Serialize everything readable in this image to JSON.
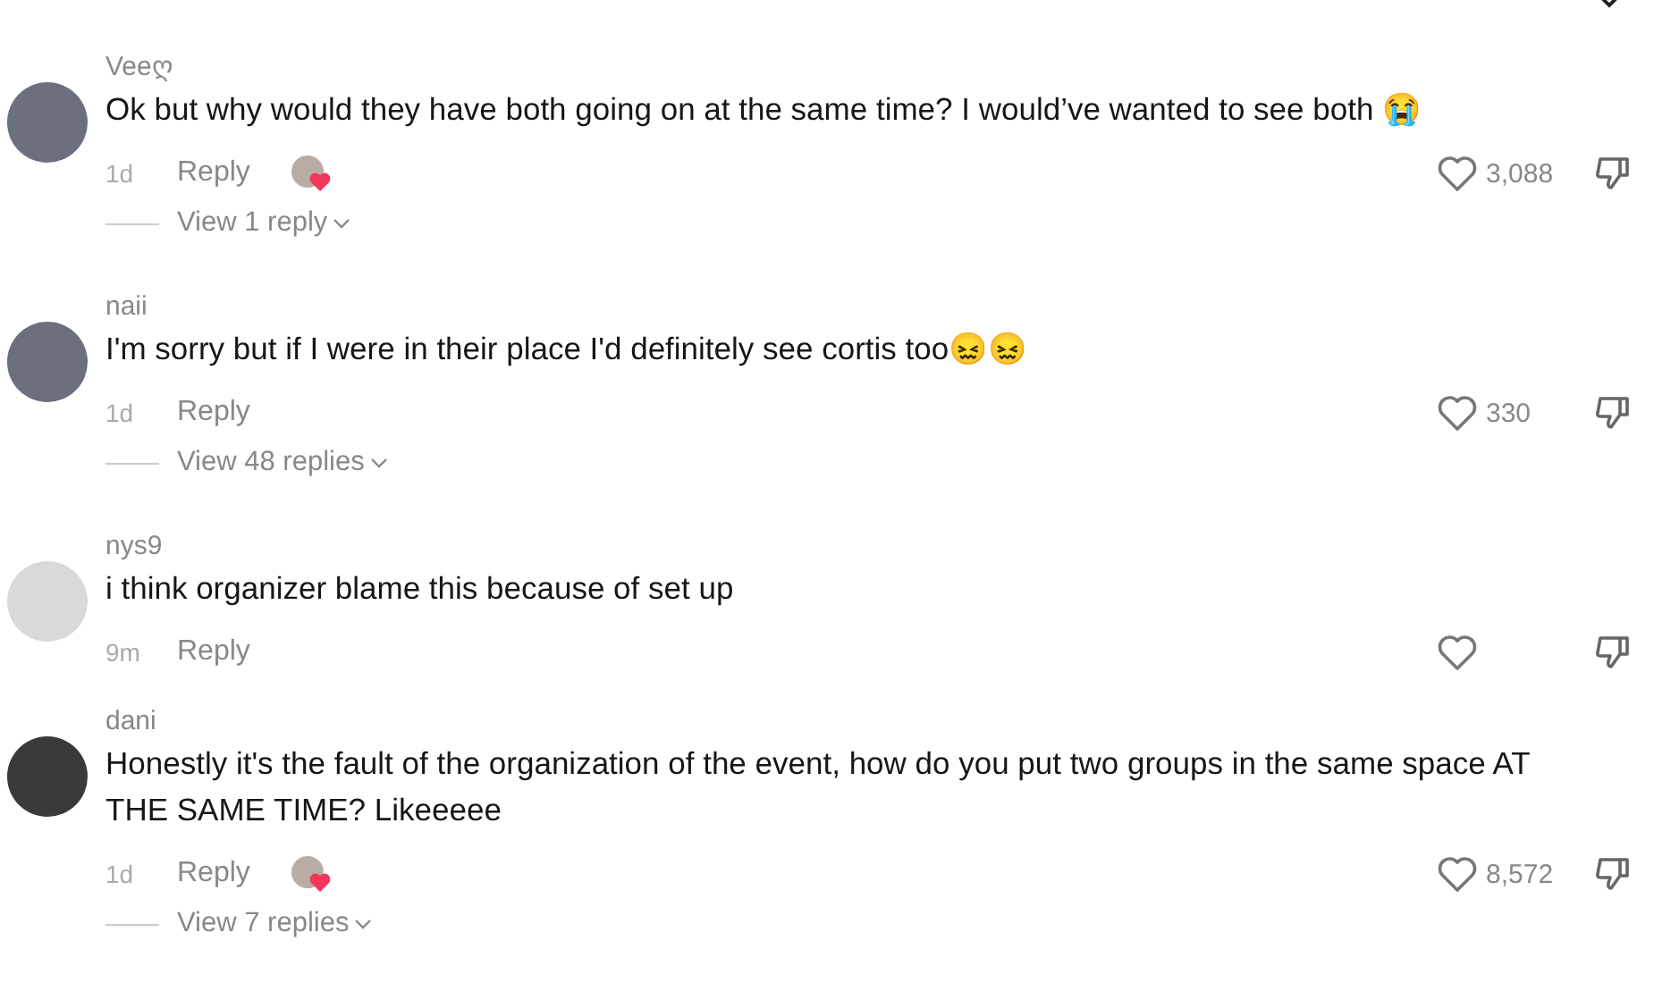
{
  "comments": [
    {
      "username": "Veeღ",
      "text": "Ok but why would they have both going on at the same time? I would’ve wanted to see both 😭",
      "time": "1d",
      "reply": "Reply",
      "liked_by_creator": true,
      "likes": "3,088",
      "view_replies": "View 1 reply"
    },
    {
      "username": "naii",
      "text": "I'm sorry but if I were in their place I'd definitely see cortis too😖😖",
      "time": "1d",
      "reply": "Reply",
      "liked_by_creator": false,
      "likes": "330",
      "view_replies": "View 48 replies"
    },
    {
      "username": "nys9",
      "text": "i think organizer blame this because of set up",
      "time": "9m",
      "reply": "Reply",
      "liked_by_creator": false
    },
    {
      "username": "dani",
      "text": "Honestly it's the fault of the organization of the event, how do you put two groups in the same space AT THE SAME TIME? Likeeeee",
      "time": "1d",
      "reply": "Reply",
      "liked_by_creator": true,
      "likes": "8,572",
      "view_replies": "View 7 replies"
    }
  ]
}
